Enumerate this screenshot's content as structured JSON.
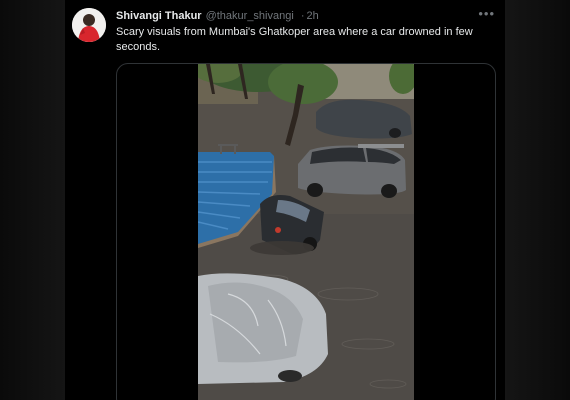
{
  "tweet": {
    "author_name": "Shivangi Thakur",
    "handle": "@thakur_shivangi",
    "separator": "·",
    "time": "2h",
    "more_icon": "more-icon",
    "text": "Scary visuals from Mumbai's Ghatkoper area where a car drowned in few seconds."
  },
  "media": {
    "type": "video",
    "scene_colors": {
      "water": "#55504a",
      "roof": "#2d6fa8",
      "silver_car": "#6b6d70",
      "dark_car": "#2a2d31",
      "covered_car": "#b8bcc0"
    }
  },
  "colors": {
    "background": "#000000",
    "primary_text": "#e7e9ea",
    "secondary_text": "#71767b",
    "border": "#2f3336",
    "avatar_accent": "#d8262d"
  }
}
